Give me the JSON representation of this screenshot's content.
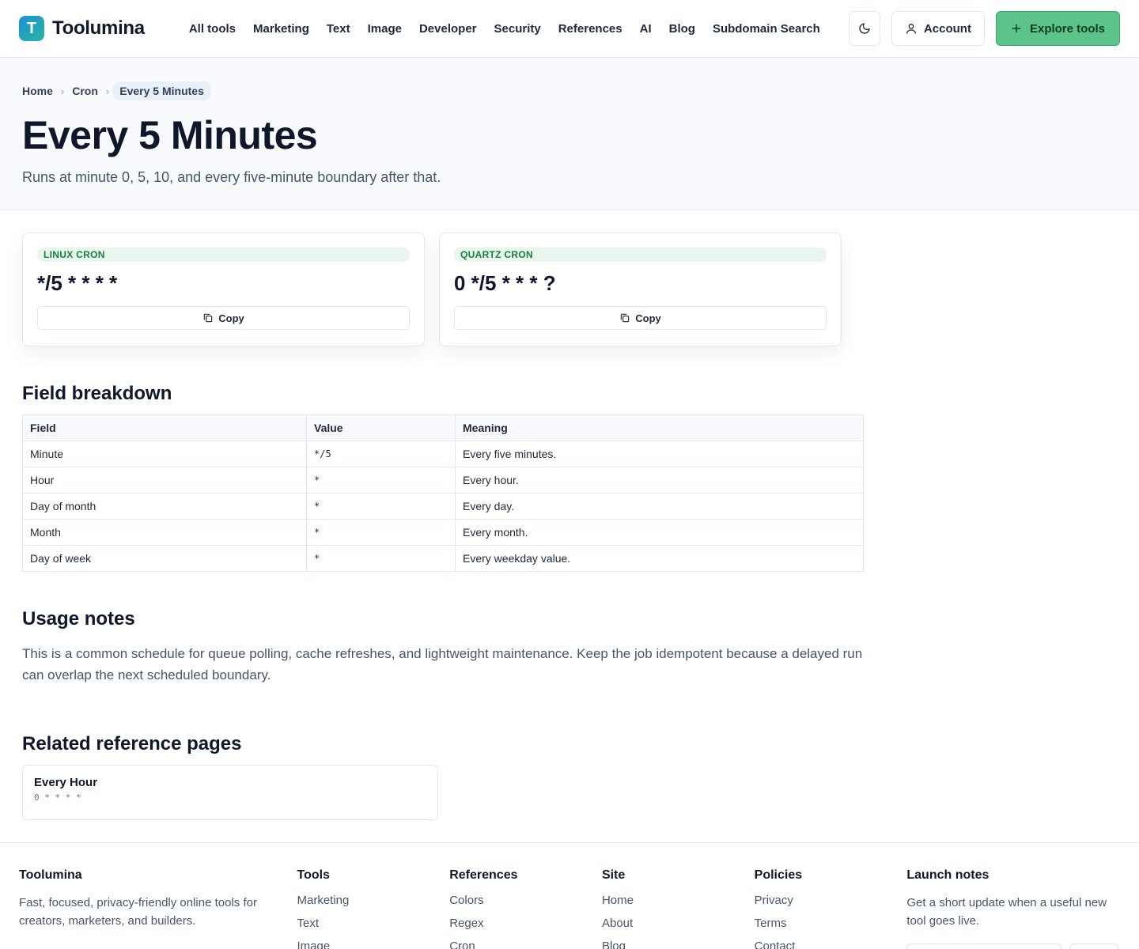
{
  "brand": {
    "logo_letter": "T",
    "name": "Toolumina"
  },
  "nav": [
    {
      "label": "All tools"
    },
    {
      "label": "Marketing"
    },
    {
      "label": "Text"
    },
    {
      "label": "Image"
    },
    {
      "label": "Developer"
    },
    {
      "label": "Security"
    },
    {
      "label": "References"
    },
    {
      "label": "AI"
    },
    {
      "label": "Blog"
    },
    {
      "label": "Subdomain Search"
    }
  ],
  "header_actions": {
    "account_label": "Account",
    "explore_label": "Explore tools",
    "theme_icon": "moon-icon"
  },
  "breadcrumb": {
    "home": "Home",
    "section": "Cron",
    "current": "Every 5 Minutes"
  },
  "page": {
    "title": "Every 5 Minutes",
    "subtitle": "Runs at minute 0, 5, 10, and every five-minute boundary after that."
  },
  "cards": [
    {
      "label": "LINUX CRON",
      "expression": "*/5 * * * *",
      "copy_label": "Copy"
    },
    {
      "label": "QUARTZ CRON",
      "expression": "0 */5 * * * ?",
      "copy_label": "Copy"
    }
  ],
  "breakdown": {
    "heading": "Field breakdown",
    "columns": [
      "Field",
      "Value",
      "Meaning"
    ],
    "rows": [
      [
        "Minute",
        "*/5",
        "Every five minutes."
      ],
      [
        "Hour",
        "*",
        "Every hour."
      ],
      [
        "Day of month",
        "*",
        "Every day."
      ],
      [
        "Month",
        "*",
        "Every month."
      ],
      [
        "Day of week",
        "*",
        "Every weekday value."
      ]
    ]
  },
  "usage": {
    "heading": "Usage notes",
    "text": "This is a common schedule for queue polling, cache refreshes, and lightweight maintenance. Keep the job idempotent because a delayed run can overlap the next scheduled boundary."
  },
  "related": {
    "heading": "Related reference pages",
    "items": [
      {
        "title": "Every Hour",
        "expression": "0 * * * *"
      }
    ]
  },
  "footer": {
    "brand": {
      "heading": "Toolumina",
      "text": "Fast, focused, privacy-friendly online tools for creators, marketers, and builders."
    },
    "tools": {
      "heading": "Tools",
      "links": [
        "Marketing",
        "Text",
        "Image"
      ]
    },
    "references": {
      "heading": "References",
      "links": [
        "Colors",
        "Regex",
        "Cron"
      ]
    },
    "site": {
      "heading": "Site",
      "links": [
        "Home",
        "About",
        "Blog"
      ]
    },
    "policies": {
      "heading": "Policies",
      "links": [
        "Privacy",
        "Terms",
        "Contact"
      ]
    },
    "launch": {
      "heading": "Launch notes",
      "text": "Get a short update when a useful new tool goes live."
    }
  }
}
